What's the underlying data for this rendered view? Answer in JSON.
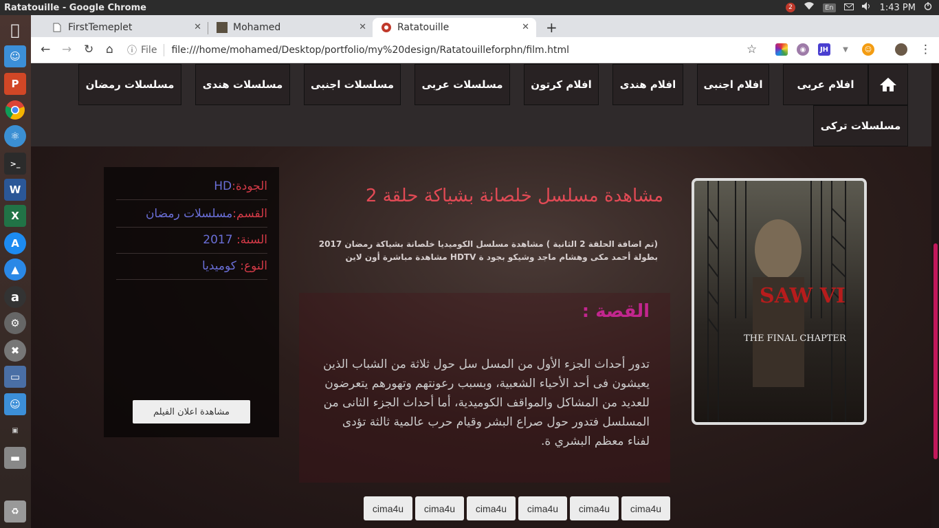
{
  "window": {
    "title": "Ratatouille - Google Chrome"
  },
  "tray": {
    "notifications": "2",
    "keyboard": "En",
    "time": "1:43 PM"
  },
  "tabs": [
    {
      "label": "FirstTemeplet"
    },
    {
      "label": "Mohamed"
    },
    {
      "label": "Ratatouille"
    }
  ],
  "address": {
    "scheme_label": "File",
    "url": "file:///home/mohamed/Desktop/portfolio/my%20design/Ratatouilleforphn/film.html"
  },
  "nav": {
    "items": [
      "افلام عربى",
      "افلام اجنبى",
      "افلام هندى",
      "افلام كرتون",
      "مسلسلات عربى",
      "مسلسلات اجنبى",
      "مسلسلات هندى",
      "مسلسلات رمضان",
      "مسلسلات تركى"
    ]
  },
  "movie": {
    "title": "مشاهدة مسلسل خلصانة بشياكة حلقة 2",
    "summary": "(تم اضافة الحلقة 2 الثانية ) مشاهدة مسلسل الكوميديا خلصانة بشياكة رمضان 2017 بطولة أحمد مكى وهشام ماجد وشيكو بجود ة HDTV مشاهدة مباشرة أون لاين",
    "story_heading": "القصة :",
    "story": "تدور أحداث الجزء الأول من المسل سل حول ثلاثة من الشباب الذين يعيشون فى أحد الأحياء الشعبية، وبسبب رعونتهم وتهورهم يتعرضون للعديد من المشاكل والمواقف الكوميدية، أما أحداث الجزء الثانى من المسلسل فتدور حول صراع البشر وقيام حرب عالمية ثالثة تؤدى لفناء معظم البشري ة.",
    "poster_text_1": "SAW VI",
    "poster_text_2": "THE FINAL CHAPTER"
  },
  "info": {
    "rows": [
      {
        "key": "الجودة:",
        "value": "HD"
      },
      {
        "key": "القسم:",
        "value": "مسلسلات رمضان"
      },
      {
        "key": "السنة: ",
        "value": "2017"
      },
      {
        "key": "النوع: ",
        "value": "كوميديا"
      }
    ],
    "trailer_button": "مشاهدة اعلان الفيلم"
  },
  "sources": [
    "cima4u",
    "cima4u",
    "cima4u",
    "cima4u",
    "cima4u",
    "cima4u"
  ],
  "colors": {
    "title_red": "#e24a55",
    "story_heading": "#c2268e",
    "info_value": "#6a6fd8",
    "scroll_accent": "#c2185b"
  }
}
